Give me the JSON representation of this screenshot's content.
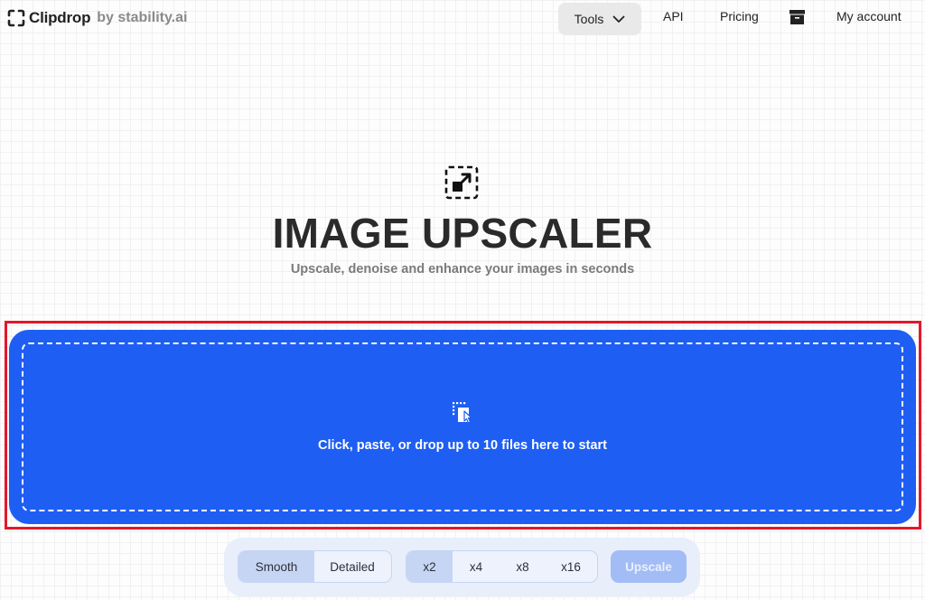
{
  "header": {
    "logo_text": "Clipdrop",
    "logo_sub": "by stability.ai",
    "nav": {
      "tools_label": "Tools",
      "api_label": "API",
      "pricing_label": "Pricing",
      "account_label": "My account"
    }
  },
  "hero": {
    "title": "IMAGE UPSCALER",
    "subtitle": "Upscale, denoise and enhance your images in seconds"
  },
  "dropzone": {
    "text": "Click, paste, or drop up to 10 files here to start",
    "background_color": "#1e5ef3",
    "highlight_color": "#e3182a"
  },
  "controls": {
    "mode_options": [
      {
        "label": "Smooth",
        "active": true
      },
      {
        "label": "Detailed",
        "active": false
      }
    ],
    "scale_options": [
      {
        "label": "x2",
        "active": true
      },
      {
        "label": "x4",
        "active": false
      },
      {
        "label": "x8",
        "active": false
      },
      {
        "label": "x16",
        "active": false
      }
    ],
    "upscale_label": "Upscale"
  }
}
